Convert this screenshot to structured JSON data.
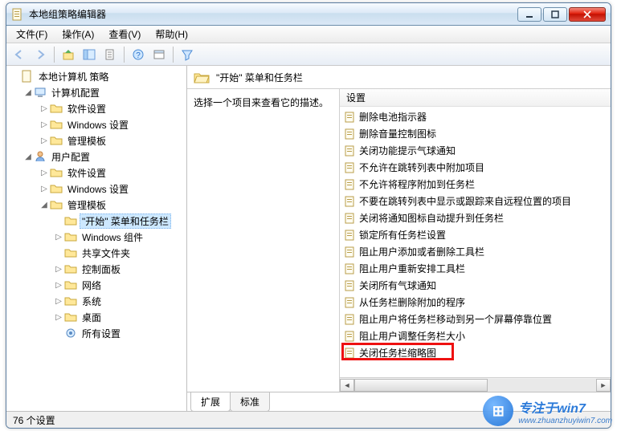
{
  "window": {
    "title": "本地组策略编辑器"
  },
  "menubar": [
    "文件(F)",
    "操作(A)",
    "查看(V)",
    "帮助(H)"
  ],
  "tree": {
    "root": "本地计算机 策略",
    "computer": {
      "label": "计算机配置",
      "children": [
        "软件设置",
        "Windows 设置",
        "管理模板"
      ]
    },
    "user": {
      "label": "用户配置",
      "soft": "软件设置",
      "winset": "Windows 设置",
      "admin": {
        "label": "管理模板",
        "startmenu": "\"开始\" 菜单和任务栏",
        "wincomp": "Windows 组件",
        "share": "共享文件夹",
        "ctrlpanel": "控制面板",
        "network": "网络",
        "system": "系统",
        "desktop": "桌面",
        "allset": "所有设置"
      }
    }
  },
  "content": {
    "header": "\"开始\" 菜单和任务栏",
    "desc_prompt": "选择一个项目来查看它的描述。",
    "settings_col": "设置",
    "items": [
      "删除电池指示器",
      "删除音量控制图标",
      "关闭功能提示气球通知",
      "不允许在跳转列表中附加项目",
      "不允许将程序附加到任务栏",
      "不要在跳转列表中显示或跟踪来自远程位置的项目",
      "关闭将通知图标自动提升到任务栏",
      "锁定所有任务栏设置",
      "阻止用户添加或者删除工具栏",
      "阻止用户重新安排工具栏",
      "关闭所有气球通知",
      "从任务栏删除附加的程序",
      "阻止用户将任务栏移动到另一个屏幕停靠位置",
      "阻止用户调整任务栏大小",
      "关闭任务栏缩略图"
    ],
    "highlight_index": 14
  },
  "tabs": {
    "extended": "扩展",
    "standard": "标准"
  },
  "statusbar": "76 个设置",
  "watermark": {
    "text": "专注于win7",
    "url": "www.zhuanzhuyiwin7.com"
  }
}
